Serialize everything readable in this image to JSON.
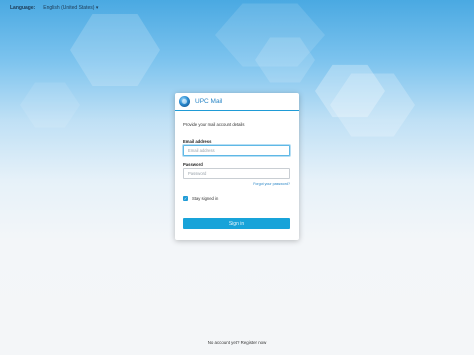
{
  "header": {
    "language_label": "Language:",
    "language_value": "English (United States)",
    "language_caret": "▾"
  },
  "card": {
    "title": "UPC Mail",
    "intro": "Provide your mail account details",
    "email_label": "Email address",
    "email_placeholder": "Email address",
    "email_value": "",
    "password_label": "Password",
    "password_placeholder": "Password",
    "password_value": "",
    "forgot_link": "Forgot your password?",
    "stay_signed_in_label": "Stay signed in",
    "stay_signed_in_checked": true,
    "checkmark": "✓",
    "signin_button": "Sign in"
  },
  "footer": {
    "no_account_text": "No account yet?",
    "register_link": "Register now"
  },
  "colors": {
    "accent": "#1f9bd6",
    "button": "#18a3d9",
    "link": "#2a86c6"
  }
}
